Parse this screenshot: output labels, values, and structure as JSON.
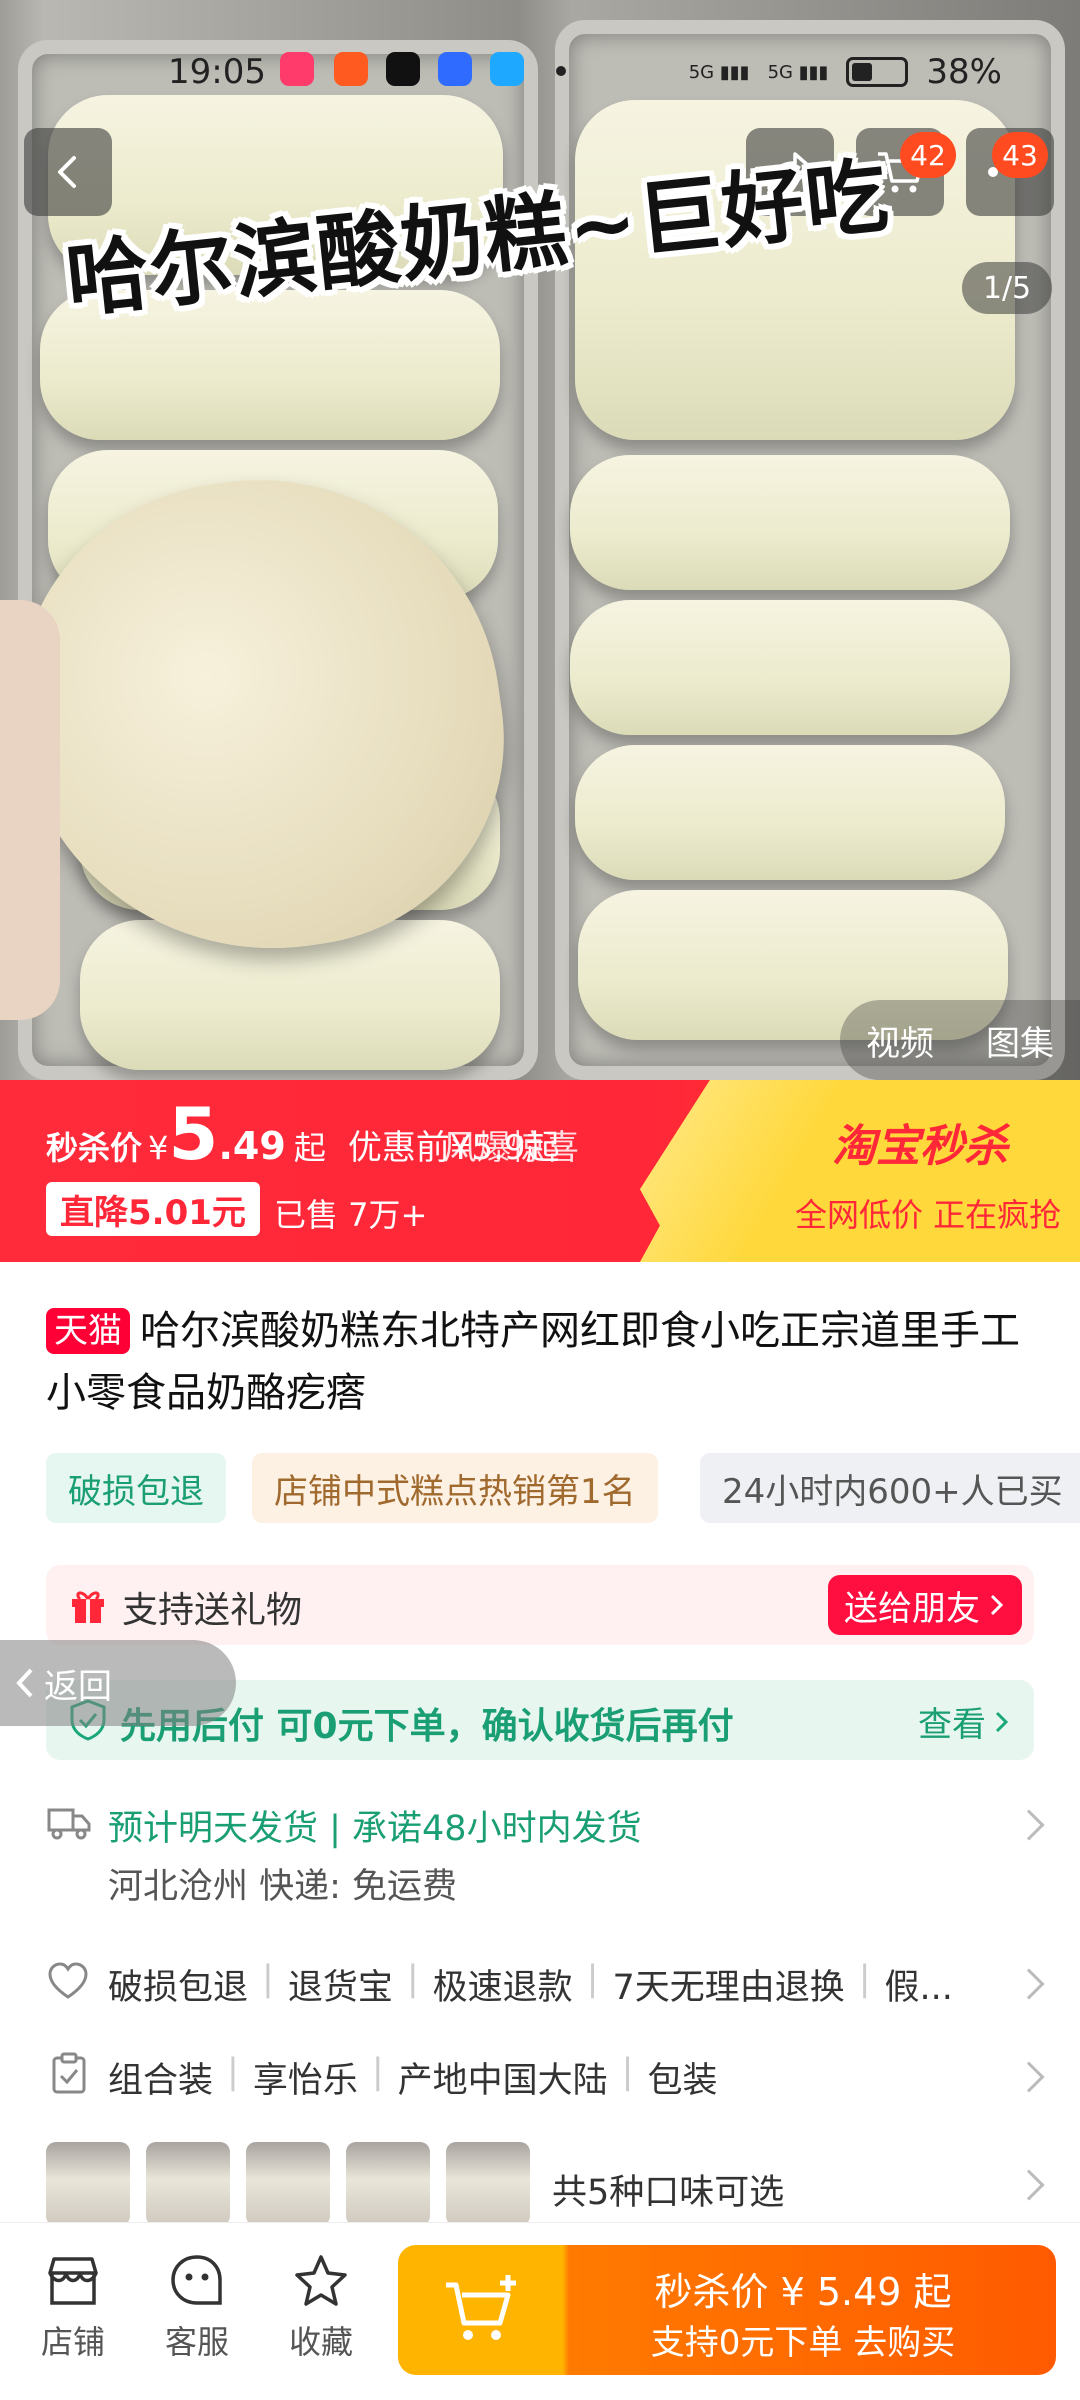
{
  "status_bar": {
    "time": "19:05",
    "battery": "38%",
    "signal_1": "5G",
    "signal_2": "5G"
  },
  "hero": {
    "overlay_title": "哈尔滨酸奶糕~巨好吃",
    "pager": "1/5",
    "cart_badge": "42",
    "more_badge": "43",
    "tabs": [
      "视频",
      "图集"
    ]
  },
  "promo": {
    "price_label": "秒杀价",
    "currency": "¥",
    "price_int": "5",
    "price_dec": ".49",
    "price_suffix": "起",
    "overlay_text": "优惠前¥5.9起",
    "overlay_text_2": "风爆惊喜",
    "drop_label": "直降5.01元",
    "sold": "已售 7万+",
    "brand": "淘宝秒杀",
    "brand_sub": "全网低价 正在疯抢"
  },
  "product": {
    "store_badge": "天猫",
    "title": "哈尔滨酸奶糕东北特产网红即食小吃正宗道里手工小零食品奶酪疙瘩",
    "tags": [
      "破损包退",
      "店铺中式糕点热销第1名",
      "24小时内600+人已买"
    ]
  },
  "gift": {
    "label": "支持送礼物",
    "button": "送给朋友"
  },
  "back_float": "返回",
  "pay_later": {
    "text": "先用后付 可0元下单，确认收货后再付",
    "action": "查看"
  },
  "shipping": {
    "line1": "预计明天发货 | 承诺48小时内发货",
    "line2": "河北沧州  快递: 免运费"
  },
  "guarantees": [
    "破损包退",
    "退货宝",
    "极速退款",
    "7天无理由退换",
    "假..."
  ],
  "specs": [
    "组合装",
    "享怡乐",
    "产地中国大陆",
    "包装"
  ],
  "variants": {
    "text": "共5种口味可选"
  },
  "bottom_bar": {
    "store": "店铺",
    "service": "客服",
    "favorite": "收藏",
    "buy_price": "秒杀价 ¥ 5.49 起",
    "buy_sub": "支持0元下单  去购买"
  },
  "colors": {
    "accent": "#ff2738",
    "orange": "#ff5a00",
    "green": "#1aa87a",
    "yellow": "#ffd83b"
  }
}
